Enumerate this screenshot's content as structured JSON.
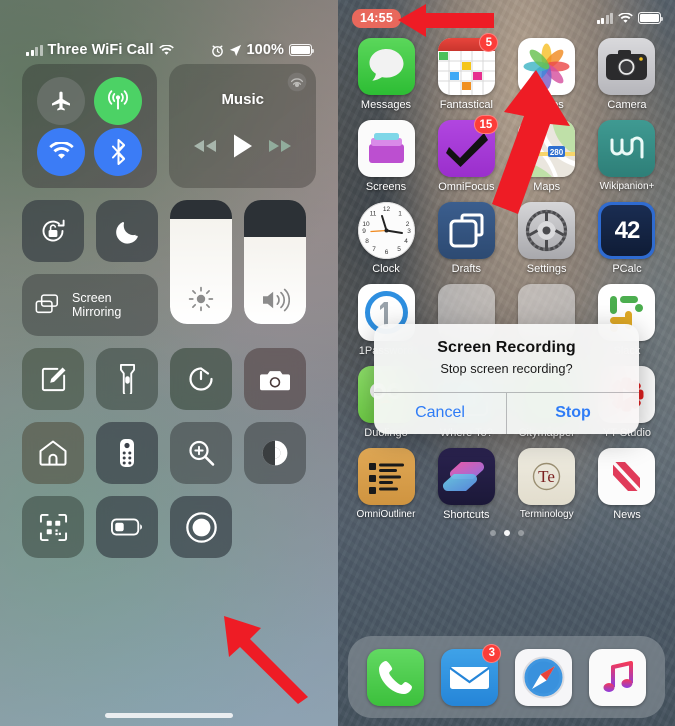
{
  "control_center": {
    "status_bar": {
      "carrier": "Three WiFi Call",
      "battery_percent": "100%",
      "icons": [
        "cellular-bars-icon",
        "wifi-icon",
        "alarm-icon",
        "location-arrow-icon",
        "battery-icon"
      ]
    },
    "connectivity": {
      "airplane_mode": {
        "name": "airplane-mode-toggle",
        "state": "off"
      },
      "cellular_data": {
        "name": "cellular-data-toggle",
        "state": "on"
      },
      "wifi": {
        "name": "wifi-toggle",
        "state": "on"
      },
      "bluetooth": {
        "name": "bluetooth-toggle",
        "state": "on"
      }
    },
    "music": {
      "title": "Music",
      "airplay_label": "airplay-icon",
      "controls": [
        "rewind-button",
        "play-button",
        "fast-forward-button"
      ]
    },
    "toggles": {
      "rotation_lock": "rotation-lock-toggle",
      "do_not_disturb": "do-not-disturb-toggle",
      "screen_mirroring_line1": "Screen",
      "screen_mirroring_line2": "Mirroring"
    },
    "sliders": {
      "brightness_label": "brightness-slider",
      "brightness_value": 85,
      "volume_label": "volume-slider",
      "volume_value": 70
    },
    "shortcuts": [
      "notes-shortcut",
      "flashlight-shortcut",
      "timer-shortcut",
      "camera-shortcut",
      "home-shortcut",
      "apple-tv-remote-shortcut",
      "magnifier-shortcut",
      "accessibility-shortcut",
      "qr-code-scanner-shortcut",
      "low-power-mode-shortcut",
      "screen-recording-shortcut"
    ]
  },
  "home_screen": {
    "status_bar": {
      "recording_time": "14:55",
      "icons": [
        "cellular-bars-icon",
        "wifi-icon",
        "battery-icon"
      ]
    },
    "rows": [
      [
        {
          "label": "Messages",
          "icon": "messages-icon",
          "badge": null
        },
        {
          "label": "Fantastical",
          "icon": "fantastical-icon",
          "badge": "5"
        },
        {
          "label": "Photos",
          "icon": "photos-icon",
          "badge": null
        },
        {
          "label": "Camera",
          "icon": "camera-icon",
          "badge": null
        }
      ],
      [
        {
          "label": "Screens",
          "icon": "screens-icon",
          "badge": null
        },
        {
          "label": "OmniFocus",
          "icon": "omnifocus-icon",
          "badge": "15"
        },
        {
          "label": "Maps",
          "icon": "maps-icon",
          "badge": null
        },
        {
          "label": "Wikipanion+",
          "icon": "wikipanion-icon",
          "badge": null
        }
      ],
      [
        {
          "label": "Clock",
          "icon": "clock-icon",
          "badge": null
        },
        {
          "label": "Drafts",
          "icon": "drafts-icon",
          "badge": null
        },
        {
          "label": "Settings",
          "icon": "settings-icon",
          "badge": null
        },
        {
          "label": "PCalc",
          "icon": "pcalc-icon",
          "badge": null
        }
      ],
      [
        {
          "label": "1Password",
          "icon": "1password-icon",
          "badge": null
        },
        {
          "label": "",
          "icon": "hidden-app-icon",
          "badge": null
        },
        {
          "label": "",
          "icon": "hidden-app-icon",
          "badge": null
        },
        {
          "label": "Slack",
          "icon": "slack-icon",
          "badge": null
        }
      ],
      [
        {
          "label": "Duolingo",
          "icon": "duolingo-icon",
          "badge": null
        },
        {
          "label": "Where To?",
          "icon": "where-to-icon",
          "badge": null
        },
        {
          "label": "Citymapper",
          "icon": "citymapper-icon",
          "badge": null
        },
        {
          "label": "YT Studio",
          "icon": "yt-studio-icon",
          "badge": null
        }
      ],
      [
        {
          "label": "OmniOutliner",
          "icon": "omnioutliner-icon",
          "badge": null
        },
        {
          "label": "Shortcuts",
          "icon": "shortcuts-icon",
          "badge": null
        },
        {
          "label": "Terminology",
          "icon": "terminology-icon",
          "badge": null
        },
        {
          "label": "News",
          "icon": "news-icon",
          "badge": null
        }
      ]
    ],
    "page_dots": {
      "count": 3,
      "active_index": 1
    },
    "dock": [
      {
        "label": "Phone",
        "icon": "phone-icon",
        "badge": null
      },
      {
        "label": "Mail",
        "icon": "mail-icon",
        "badge": "3"
      },
      {
        "label": "Safari",
        "icon": "safari-icon",
        "badge": null
      },
      {
        "label": "Music",
        "icon": "music-icon",
        "badge": null
      }
    ]
  },
  "alert": {
    "title": "Screen Recording",
    "message": "Stop screen recording?",
    "cancel_label": "Cancel",
    "stop_label": "Stop"
  },
  "annotations": {
    "arrow_color": "#ee1c25",
    "arrows": [
      "arrow-pointing-to-recording-time",
      "arrow-pointing-to-screen-recording-button",
      "arrow-pointing-to-stop-button"
    ]
  },
  "colors": {
    "accent_blue": "#3b7cf6",
    "accent_green": "#4cd265",
    "badge_red": "#fc3d39",
    "recording_pill": "#e8685c",
    "alert_button_blue": "#2f7cf6"
  }
}
